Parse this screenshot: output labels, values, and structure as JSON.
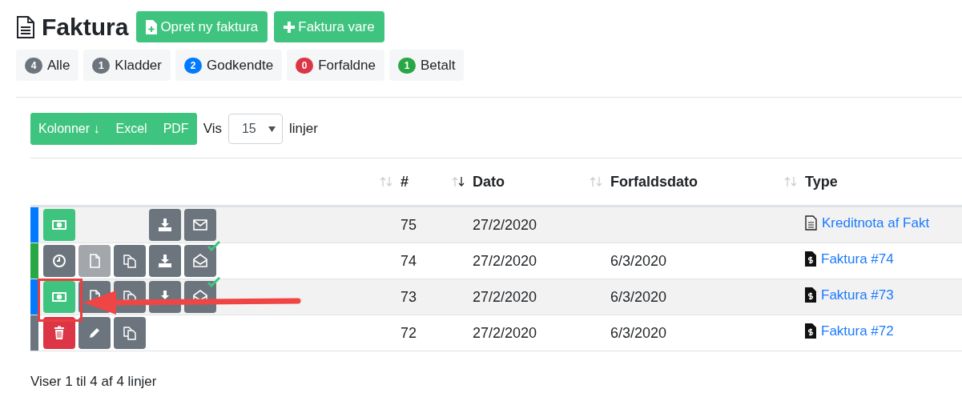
{
  "page": {
    "title": "Faktura",
    "buttons": [
      {
        "label": "Opret ny faktura",
        "kind": "new"
      },
      {
        "label": "Faktura vare",
        "kind": "plus"
      }
    ]
  },
  "filters": [
    {
      "count": "4",
      "label": "Alle",
      "color": "#6c757d"
    },
    {
      "count": "1",
      "label": "Kladder",
      "color": "#6c757d"
    },
    {
      "count": "2",
      "label": "Godkendte",
      "color": "#007bff"
    },
    {
      "count": "0",
      "label": "Forfaldne",
      "color": "#dc3545"
    },
    {
      "count": "1",
      "label": "Betalt",
      "color": "#28a745"
    }
  ],
  "toolbar": {
    "buttons": [
      "Kolonner ↓",
      "Excel",
      "PDF"
    ],
    "show_label": "Vis",
    "page_size": "15",
    "lines_label": "linjer"
  },
  "table": {
    "columns": [
      {
        "sorted": false
      },
      {
        "label": "#",
        "sorted": true
      },
      {
        "label": "Dato",
        "sorted": false
      },
      {
        "label": "Forfaldsdato",
        "sorted": false
      },
      {
        "label": "Type"
      }
    ],
    "rows": [
      {
        "color": "#007bff",
        "actions": [
          {
            "kind": "pay",
            "disabled": false
          },
          {
            "kind": "download",
            "disabled": false
          },
          {
            "kind": "mail",
            "disabled": false
          }
        ],
        "number": "75",
        "date": "27/2/2020",
        "type": {
          "kind": "credit",
          "label": "Kreditnota af Fakt"
        }
      },
      {
        "color": "#28a745",
        "actions": [
          {
            "kind": "clock",
            "disabled": false
          },
          {
            "kind": "doc",
            "disabled": true
          },
          {
            "kind": "copy",
            "disabled": false
          },
          {
            "kind": "download",
            "disabled": false
          },
          {
            "kind": "mail-sent",
            "disabled": false
          }
        ],
        "number": "74",
        "date": "27/2/2020",
        "due": "6/3/2020",
        "type": {
          "kind": "invoice",
          "label": "Faktura #74"
        }
      },
      {
        "color": "#007bff",
        "actions": [
          {
            "kind": "pay",
            "disabled": false
          },
          {
            "kind": "doc",
            "disabled": false
          },
          {
            "kind": "copy",
            "disabled": false
          },
          {
            "kind": "download",
            "disabled": false
          },
          {
            "kind": "mail-sent",
            "disabled": false
          }
        ],
        "number": "73",
        "date": "27/2/2020",
        "due": "6/3/2020",
        "type": {
          "kind": "invoice",
          "label": "Faktura #73"
        }
      },
      {
        "color": "#6c757d",
        "actions": [
          {
            "kind": "delete",
            "disabled": false
          },
          {
            "kind": "edit",
            "disabled": false
          },
          {
            "kind": "copy",
            "disabled": false
          }
        ],
        "number": "72",
        "date": "27/2/2020",
        "due": "6/3/2020",
        "type": {
          "kind": "invoice",
          "label": "Faktura #72"
        }
      }
    ]
  },
  "footer": "Viser 1 til 4 af 4 linjer"
}
